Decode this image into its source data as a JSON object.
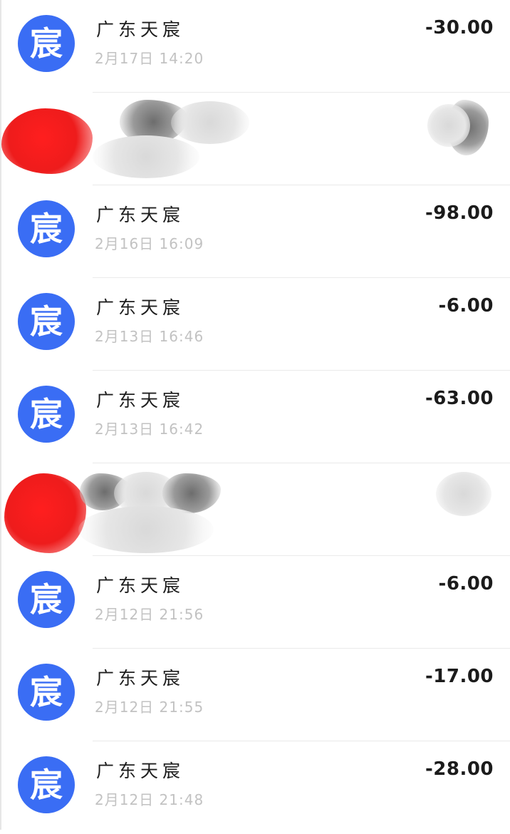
{
  "transactions": [
    {
      "merchant": "广东天宸",
      "time": "2月17日 14:20",
      "amount": "-30.00",
      "avatar_char": "宸"
    },
    {
      "merchant": "广东天宸",
      "time": "2月16日 16:09",
      "amount": "-98.00",
      "avatar_char": "宸"
    },
    {
      "merchant": "广东天宸",
      "time": "2月13日 16:46",
      "amount": "-6.00",
      "avatar_char": "宸"
    },
    {
      "merchant": "广东天宸",
      "time": "2月13日 16:42",
      "amount": "-63.00",
      "avatar_char": "宸"
    },
    {
      "merchant": "广东天宸",
      "time": "2月12日 21:56",
      "amount": "-6.00",
      "avatar_char": "宸"
    },
    {
      "merchant": "广东天宸",
      "time": "2月12日 21:55",
      "amount": "-17.00",
      "avatar_char": "宸"
    },
    {
      "merchant": "广东天宸",
      "time": "2月12日 21:48",
      "amount": "-28.00",
      "avatar_char": "宸"
    }
  ],
  "colors": {
    "avatar_bg": "#3a6df4",
    "redaction_red": "#ee1c1c",
    "time_text": "#c2c2c2"
  },
  "icons": {
    "avatar": "merchant-avatar-icon",
    "redaction": "redaction-scribble"
  }
}
